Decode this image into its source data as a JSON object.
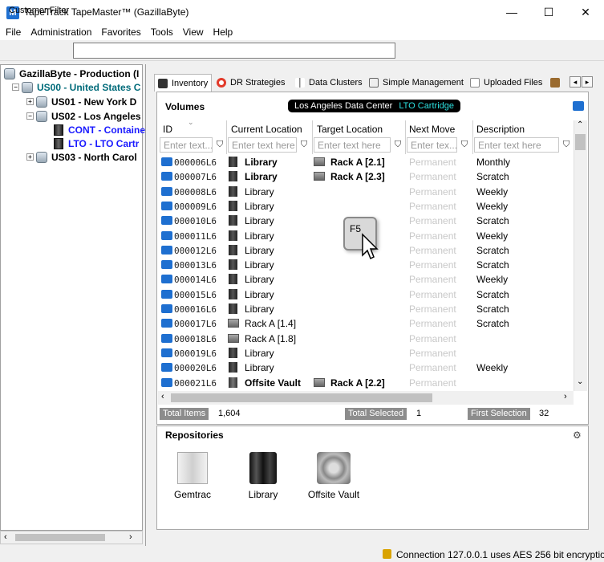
{
  "window": {
    "title": "TapeTrack TapeMaster™ (GazillaByte)",
    "icon_letter": "M",
    "min_glyph": "—",
    "max_glyph": "☐",
    "close_glyph": "✕"
  },
  "menu": [
    "File",
    "Administration",
    "Favorites",
    "Tools",
    "View",
    "Help"
  ],
  "customer_filter": {
    "label": "Customer Filter",
    "value": ""
  },
  "tree": [
    {
      "label": "GazillaByte - Production (I",
      "level": 0,
      "expander": ""
    },
    {
      "label": "US00 - United States C",
      "level": 1,
      "expander": "−",
      "color": "#006b7a"
    },
    {
      "label": "US01 - New York D",
      "level": 2,
      "expander": "+"
    },
    {
      "label": "US02 - Los Angeles",
      "level": 2,
      "expander": "−"
    },
    {
      "label": "CONT - Containe",
      "level": 3,
      "expander": "",
      "color": "#1a1aff"
    },
    {
      "label": "LTO - LTO Cartr",
      "level": 3,
      "expander": "",
      "color": "#1a1aff"
    },
    {
      "label": "US03 - North Carol",
      "level": 2,
      "expander": "+"
    }
  ],
  "tabs": [
    {
      "label": "Inventory",
      "active": true
    },
    {
      "label": "DR Strategies"
    },
    {
      "label": "Data Clusters"
    },
    {
      "label": "Simple Management"
    },
    {
      "label": "Uploaded Files"
    }
  ],
  "volumes": {
    "title": "Volumes",
    "breadcrumb_location": "Los Angeles Data Center",
    "breadcrumb_cartridge": "LTO Cartridge",
    "columns": [
      "ID",
      "Current Location",
      "Target Location",
      "Next Move",
      "Description"
    ],
    "filter_placeholders": [
      "Enter text...",
      "Enter text here",
      "Enter text here",
      "Enter tex...",
      "Enter text here"
    ],
    "rows": [
      {
        "id": "000006L6",
        "loc": "Library",
        "loc_bold": true,
        "loc_icon": "drive",
        "target": "Rack A [2.1]",
        "next": "Permanent",
        "desc": "Monthly"
      },
      {
        "id": "000007L6",
        "loc": "Library",
        "loc_bold": true,
        "loc_icon": "drive",
        "target": "Rack A [2.3]",
        "next": "Permanent",
        "desc": "Scratch"
      },
      {
        "id": "000008L6",
        "loc": "Library",
        "loc_icon": "drive",
        "target": "",
        "next": "Permanent",
        "desc": "Weekly"
      },
      {
        "id": "000009L6",
        "loc": "Library",
        "loc_icon": "drive",
        "target": "",
        "next": "Permanent",
        "desc": "Weekly"
      },
      {
        "id": "000010L6",
        "loc": "Library",
        "loc_icon": "drive",
        "target": "",
        "next": "Permanent",
        "desc": "Scratch"
      },
      {
        "id": "000011L6",
        "loc": "Library",
        "loc_icon": "drive",
        "target": "",
        "next": "Permanent",
        "desc": "Weekly"
      },
      {
        "id": "000012L6",
        "loc": "Library",
        "loc_icon": "drive",
        "target": "",
        "next": "Permanent",
        "desc": "Scratch"
      },
      {
        "id": "000013L6",
        "loc": "Library",
        "loc_icon": "drive",
        "target": "",
        "next": "Permanent",
        "desc": "Scratch"
      },
      {
        "id": "000014L6",
        "loc": "Library",
        "loc_icon": "drive",
        "target": "",
        "next": "Permanent",
        "desc": "Weekly"
      },
      {
        "id": "000015L6",
        "loc": "Library",
        "loc_icon": "drive",
        "target": "",
        "next": "Permanent",
        "desc": "Scratch"
      },
      {
        "id": "000016L6",
        "loc": "Library",
        "loc_icon": "drive",
        "target": "",
        "next": "Permanent",
        "desc": "Scratch"
      },
      {
        "id": "000017L6",
        "loc": "Rack A [1.4]",
        "loc_icon": "rack",
        "target": "",
        "next": "Permanent",
        "desc": "Scratch"
      },
      {
        "id": "000018L6",
        "loc": "Rack A [1.8]",
        "loc_icon": "rack",
        "target": "",
        "next": "Permanent",
        "desc": ""
      },
      {
        "id": "000019L6",
        "loc": "Library",
        "loc_icon": "drive",
        "target": "",
        "next": "Permanent",
        "desc": ""
      },
      {
        "id": "000020L6",
        "loc": "Library",
        "loc_icon": "drive",
        "target": "",
        "next": "Permanent",
        "desc": "Weekly"
      },
      {
        "id": "000021L6",
        "loc": "Offsite Vault",
        "loc_bold": true,
        "loc_icon": "vault",
        "target": "Rack A [2.2]",
        "next": "Permanent",
        "desc": ""
      }
    ]
  },
  "status": {
    "total_items_label": "Total Items",
    "total_items": "1,604",
    "total_selected_label": "Total Selected",
    "total_selected": "1",
    "first_selection_label": "First Selection",
    "first_selection": "32"
  },
  "repositories": {
    "title": "Repositories",
    "items": [
      "Gemtrac",
      "Library",
      "Offsite Vault"
    ]
  },
  "callout": {
    "key": "F5"
  },
  "connection": {
    "text": "Connection 127.0.0.1 uses AES 256 bit encryptio"
  },
  "colors": {
    "accent": "#1e6fd0",
    "tree_blue": "#1a1aff",
    "tree_teal": "#006b7a",
    "status_label": "#8c8c8c"
  }
}
